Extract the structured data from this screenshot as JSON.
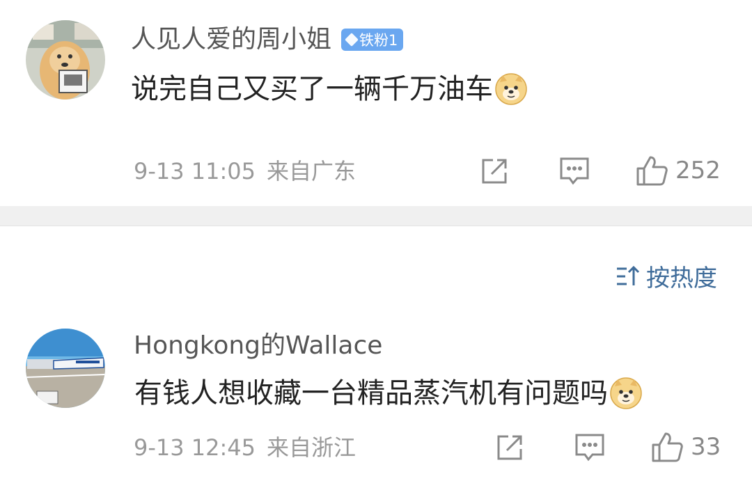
{
  "comments": [
    {
      "username": "人见人爱的周小姐",
      "badge": "铁粉1",
      "text": "说完自己又买了一辆千万油车",
      "emoji": "doge-emoji",
      "date": "9-13 11:05",
      "location": "来自广东",
      "likes": "252"
    },
    {
      "username": "Hongkong的Wallace",
      "text": "有钱人想收藏一台精品蒸汽机有问题吗",
      "emoji": "doge-emoji",
      "date": "9-13 12:45",
      "location": "来自浙江",
      "likes": "33"
    }
  ],
  "sort": {
    "label": "按热度",
    "icon": "sort-icon"
  },
  "icons": {
    "share": "share-icon",
    "comment": "comment-icon",
    "like": "like-icon"
  },
  "colors": {
    "badge": "#6aa7f0",
    "sort": "#3f6c9a",
    "meta": "#999999",
    "band": "#f0f0f0"
  }
}
